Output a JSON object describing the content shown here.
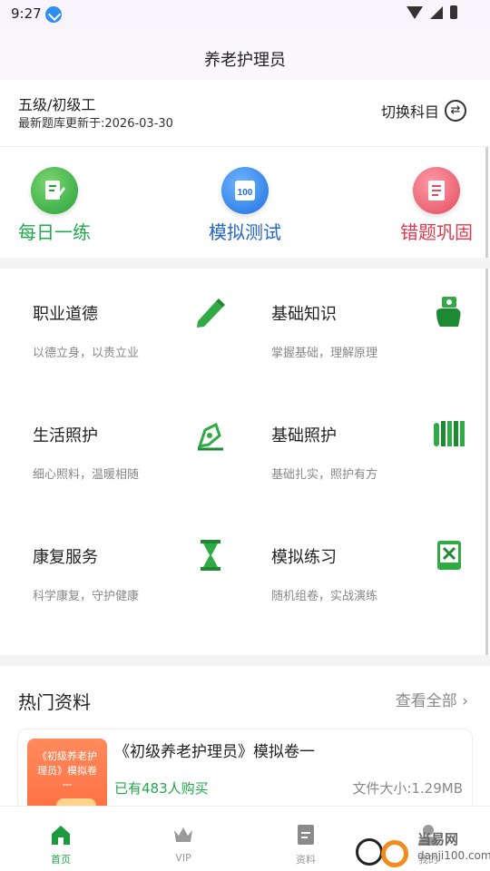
{
  "status_bar": {
    "time": "9:27"
  },
  "header": {
    "title": "养老护理员"
  },
  "subject": {
    "level": "五级/初级工",
    "update": "最新题库更新于:2026-03-30",
    "switch_label": "切换科目"
  },
  "quick_actions": [
    {
      "label": "每日一练",
      "icon": "pencil-paper-icon",
      "color": "#20a94c"
    },
    {
      "label": "模拟测试",
      "icon": "score-100-icon",
      "color": "#2466c9"
    },
    {
      "label": "错题巩固",
      "icon": "checklist-icon",
      "color": "#e03a4e"
    }
  ],
  "categories": [
    {
      "title": "职业道德",
      "desc": "以德立身，以责立业",
      "icon": "pencil-icon"
    },
    {
      "title": "基础知识",
      "desc": "掌握基础，理解原理",
      "icon": "hand-money-icon"
    },
    {
      "title": "生活照护",
      "desc": "细心照料，温暖相随",
      "icon": "pen-nib-icon"
    },
    {
      "title": "基础照护",
      "desc": "基础扎实，照护有方",
      "icon": "bamboo-scroll-icon"
    },
    {
      "title": "康复服务",
      "desc": "科学康复，守护健康",
      "icon": "hourglass-icon"
    },
    {
      "title": "模拟练习",
      "desc": "随机组卷，实战演练",
      "icon": "excel-book-icon"
    }
  ],
  "hot": {
    "title": "热门资料",
    "view_all": "查看全部",
    "item": {
      "cover_text": "《初级养老护理员》模拟卷一",
      "title": "《初级养老护理员》模拟卷一",
      "sold": "已有483人购买",
      "size": "文件大小:1.29MB"
    }
  },
  "tabs": [
    {
      "label": "首页",
      "icon": "home-icon",
      "active": true
    },
    {
      "label": "VIP",
      "icon": "crown-icon",
      "active": false
    },
    {
      "label": "资料",
      "icon": "document-icon",
      "active": false
    },
    {
      "label": "我的",
      "icon": "user-icon",
      "active": false
    }
  ],
  "watermark": {
    "text": "当易网",
    "url": "danji100.com"
  },
  "colors": {
    "accent": "#20a94c",
    "icon_green": "#2faa45"
  }
}
